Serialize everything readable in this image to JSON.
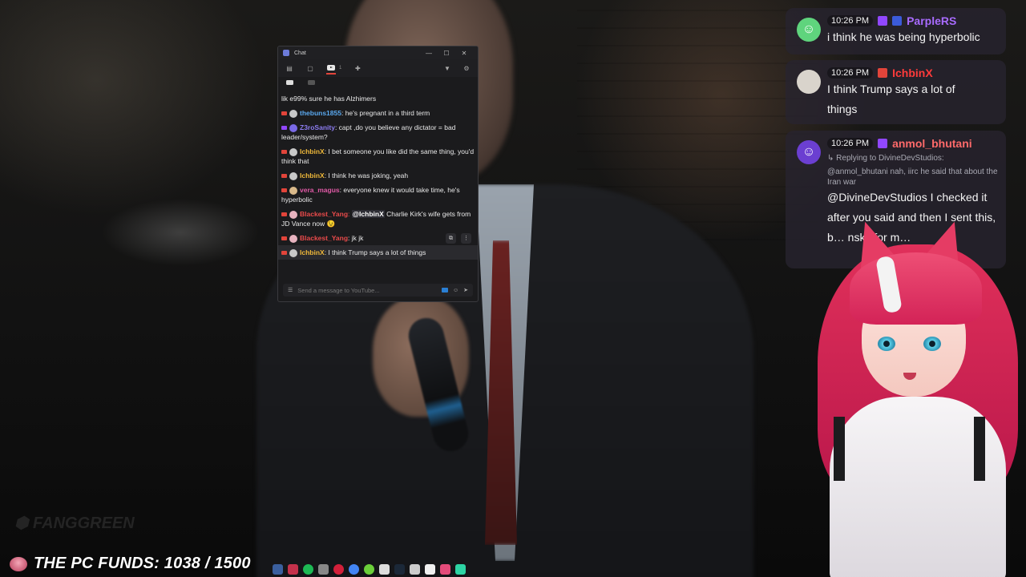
{
  "chat_window": {
    "title": "Chat",
    "tab_count": "1",
    "input_placeholder": "Send a message to YouTube...",
    "messages": [
      {
        "user": "",
        "text": "lik e99% sure he has Alzhimers",
        "user_color": "#ffffff",
        "platform": "youtube"
      },
      {
        "user": "thebuns1855",
        "text": ": he's pregnant in a third term",
        "user_color": "#5aa9f0",
        "platform": "youtube"
      },
      {
        "user": "Z3roSanity",
        "text": ": capt ,do you believe any dictator = bad leader/system?",
        "user_color": "#8c7cf0",
        "platform": "twitch"
      },
      {
        "user": "IchbinX",
        "text": ": I bet someone you like did the same thing, you'd think that",
        "user_color": "#f0b93a",
        "platform": "youtube"
      },
      {
        "user": "IchbinX",
        "text": ": I think he was joking, yeah",
        "user_color": "#f0b93a",
        "platform": "youtube"
      },
      {
        "user": "vera_magus",
        "text": ": everyone knew it would take time, he's hyperbolic",
        "user_color": "#e05aa6",
        "platform": "youtube"
      },
      {
        "user": "Blackest_Yang",
        "mention": "@IchbinX",
        "text": " Charlie Kirk's wife gets from JD Vance now 😉",
        "user_color": "#e84a4a",
        "platform": "youtube"
      },
      {
        "user": "Blackest_Yang",
        "text": ": jk jk",
        "user_color": "#e84a4a",
        "platform": "youtube"
      },
      {
        "user": "IchbinX",
        "text": ": I think Trump says a lot of things",
        "user_color": "#f0b93a",
        "platform": "youtube"
      }
    ]
  },
  "overlay_messages": [
    {
      "time": "10:26 PM",
      "name": "ParpleRS",
      "name_color": "#a86bff",
      "platform": "twitch",
      "text": "i think he was being hyperbolic"
    },
    {
      "time": "10:26 PM",
      "name": "IchbinX",
      "name_color": "#ff3b3b",
      "platform": "youtube",
      "text": "I think Trump says a lot of things"
    },
    {
      "time": "10:26 PM",
      "name": "anmol_bhutani",
      "name_color": "#ff6a6a",
      "platform": "twitch",
      "reply_label": "↳ Replying to DivineDevStudios:",
      "reply_text": "@anmol_bhutani nah, iirc he said that about the Iran war",
      "text": "@DivineDevStudios I checked it after you said and then I sent this, b… nsky for m…"
    }
  ],
  "funds": {
    "label": "THE PC FUNDS: 1038 / 1500",
    "current": 1038,
    "goal": 1500
  },
  "colors": {
    "youtube": "#e2443a",
    "twitch": "#9147ff",
    "accent": "#5aa9f0"
  },
  "taskbar_icons": [
    "steam-icon",
    "spotify-icon",
    "chrome-icon",
    "opera-icon",
    "discord-icon",
    "obs-icon",
    "folder-icon",
    "terminal-icon",
    "notes-icon",
    "app-icon"
  ]
}
